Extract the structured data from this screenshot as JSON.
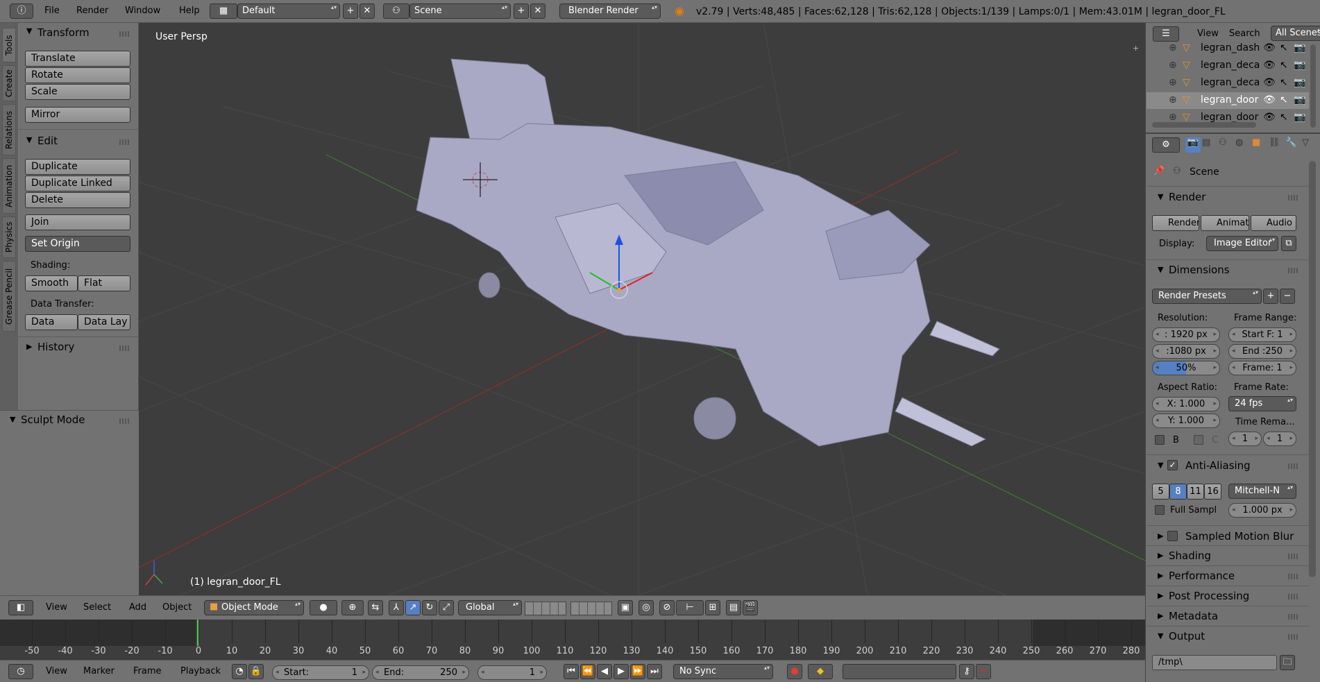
{
  "top_menu": {
    "items": [
      "File",
      "Render",
      "Window",
      "Help"
    ],
    "layout": "Default",
    "scene": "Scene",
    "engine": "Blender Render",
    "stats": "v2.79 | Verts:48,485 | Faces:62,128 | Tris:62,128 | Objects:1/139 | Lamps:0/1 | Mem:43.01M | legran_door_FL"
  },
  "tool_tabs": [
    "Tools",
    "Create",
    "Relations",
    "Animation",
    "Physics",
    "Grease Pencil"
  ],
  "transform": {
    "title": "Transform",
    "buttons": [
      "Translate",
      "Rotate",
      "Scale",
      "Mirror"
    ]
  },
  "edit": {
    "title": "Edit",
    "buttons": [
      "Duplicate",
      "Duplicate Linked",
      "Delete",
      "Join"
    ],
    "set_origin": "Set Origin",
    "shading_label": "Shading:",
    "smooth": "Smooth",
    "flat": "Flat",
    "data_transfer_label": "Data Transfer:",
    "data": "Data",
    "data_lay": "Data Lay"
  },
  "history": "History",
  "sculpt": "Sculpt Mode",
  "viewport": {
    "persp_label": "User Persp",
    "object_label": "(1) legran_door_FL"
  },
  "viewport_header": {
    "menus": [
      "View",
      "Select",
      "Add",
      "Object"
    ],
    "mode": "Object Mode",
    "orientation": "Global"
  },
  "timeline": {
    "ticks": [
      -50,
      -40,
      -30,
      -20,
      -10,
      0,
      10,
      20,
      30,
      40,
      50,
      60,
      70,
      80,
      90,
      100,
      110,
      120,
      130,
      140,
      150,
      160,
      170,
      180,
      190,
      200,
      210,
      220,
      230,
      240,
      250,
      260,
      270,
      280
    ],
    "current_frame": 1,
    "start_label": "Start:",
    "start": "1",
    "end_label": "End:",
    "end": "250",
    "frame": "1",
    "menus": [
      "View",
      "Marker",
      "Frame",
      "Playback"
    ],
    "sync": "No Sync"
  },
  "outliner": {
    "menus": [
      "View",
      "Search"
    ],
    "scenes": "All Scenes",
    "rows": [
      "legran_dash",
      "legran_deca",
      "legran_deca",
      "legran_door",
      "legran_door"
    ],
    "selected_row": 3
  },
  "properties": {
    "scene": "Scene",
    "render": {
      "title": "Render",
      "render_btn": "Render",
      "anim_btn": "Animat",
      "audio_btn": "Audio",
      "display_label": "Display:",
      "display": "Image Editor"
    },
    "dimensions": {
      "title": "Dimensions",
      "presets": "Render Presets",
      "resolution_label": "Resolution:",
      "res_x": ": 1920 px",
      "res_y": ":1080 px",
      "res_pct": "50%",
      "frame_range_label": "Frame Range:",
      "start_f": "Start F: 1",
      "end_f": "End :250",
      "frame": "Frame: 1",
      "aspect_label": "Aspect Ratio:",
      "asp_x": "X:  1.000",
      "asp_y": "Y:  1.000",
      "frame_rate_label": "Frame Rate:",
      "fps": "24 fps",
      "time_remap_label": "Time Rema...",
      "tr_old": "1",
      "tr_new": "1",
      "b_label": "B",
      "c_label": "C"
    },
    "aa": {
      "title": "Anti-Aliasing",
      "samples": [
        "5",
        "8",
        "11",
        "16"
      ],
      "selected": "8",
      "filter": "Mitchell-N",
      "full_sample": "Full Sampl",
      "filter_size": "1.000 px"
    },
    "collapsed": [
      "Sampled Motion Blur",
      "Shading",
      "Performance",
      "Post Processing",
      "Metadata"
    ],
    "output": {
      "title": "Output",
      "path": "/tmp\\"
    }
  },
  "colors": {
    "accent_blue": "#5680c2",
    "viewport_bg": "#3d3d3d",
    "panel_bg": "#727272",
    "header_bg": "#727272"
  }
}
